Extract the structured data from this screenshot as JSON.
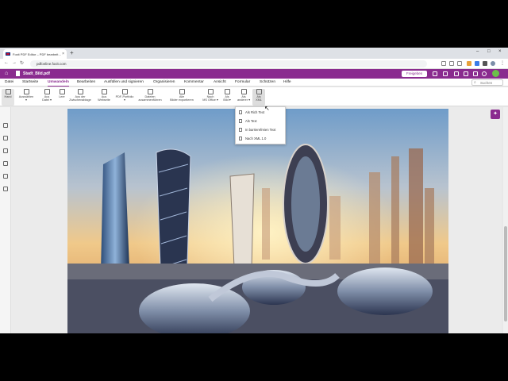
{
  "browser": {
    "tab_title": "Foxit PDF Editor – PDF bearbeit…",
    "tab_close": "×",
    "new_tab": "+",
    "url": "pdfonline.foxit.com",
    "window_controls": [
      "–",
      "□",
      "×"
    ]
  },
  "app": {
    "doc_title": "Stadt_Bild.pdf",
    "share_label": "Freigeben",
    "avatar_initial": "",
    "brand_color": "#8a2b8f"
  },
  "menu": [
    {
      "label": "Datei"
    },
    {
      "label": "Startseite"
    },
    {
      "label": "Umwandeln",
      "active": true
    },
    {
      "label": "Bearbeiten"
    },
    {
      "label": "Ausfüllen und signieren"
    },
    {
      "label": "Organisieren"
    },
    {
      "label": "Kommentar"
    },
    {
      "label": "Ansicht"
    },
    {
      "label": "Formular"
    },
    {
      "label": "Schützen"
    },
    {
      "label": "Hilfe"
    }
  ],
  "search": {
    "placeholder": "Suchen"
  },
  "ribbon": [
    {
      "line1": "Hand",
      "line2": ""
    },
    {
      "line1": "Auswählen",
      "line2": "▾"
    },
    {
      "line1": "Aus",
      "line2": "Datei ▾"
    },
    {
      "line1": "Leer",
      "line2": ""
    },
    {
      "line1": "Aus der",
      "line2": "Zwischenablage"
    },
    {
      "line1": "Aus",
      "line2": "Webseite"
    },
    {
      "line1": "PDF-Portfolio",
      "line2": "▾"
    },
    {
      "line1": "Dateien",
      "line2": "zusammenführen"
    },
    {
      "line1": "Alle",
      "line2": "Bilder exportieren"
    },
    {
      "line1": "Nach",
      "line2": "MS Office ▾"
    },
    {
      "line1": "Als",
      "line2": "Bild ▾"
    },
    {
      "line1": "Als",
      "line2": "anderer ▾"
    },
    {
      "line1": "Als",
      "line2": "XML"
    }
  ],
  "dropdown": [
    {
      "label": "Als Rich Text"
    },
    {
      "label": "Als Text"
    },
    {
      "label": "In barrierefreien Text"
    },
    {
      "label": "Nach XML 1.0"
    }
  ]
}
